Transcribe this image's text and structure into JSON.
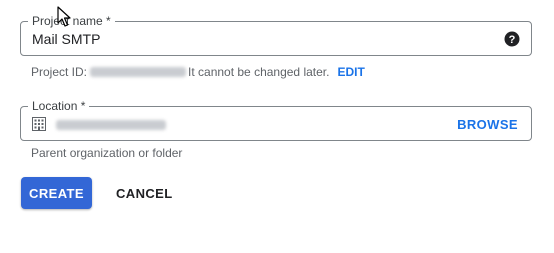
{
  "project_name": {
    "label": "Project name *",
    "value": "Mail SMTP",
    "help_icon": "help-circle-icon"
  },
  "project_id": {
    "prefix": "Project ID:",
    "suffix": "It cannot be changed later.",
    "edit_label": "EDIT"
  },
  "location": {
    "label": "Location *",
    "icon": "building-icon",
    "browse_label": "BROWSE",
    "hint": "Parent organization or folder"
  },
  "actions": {
    "create_label": "CREATE",
    "cancel_label": "CANCEL"
  },
  "colors": {
    "accent": "#1a73e8",
    "primary_button": "#3367d6",
    "border": "#80868b",
    "secondary_text": "#5f6368"
  }
}
